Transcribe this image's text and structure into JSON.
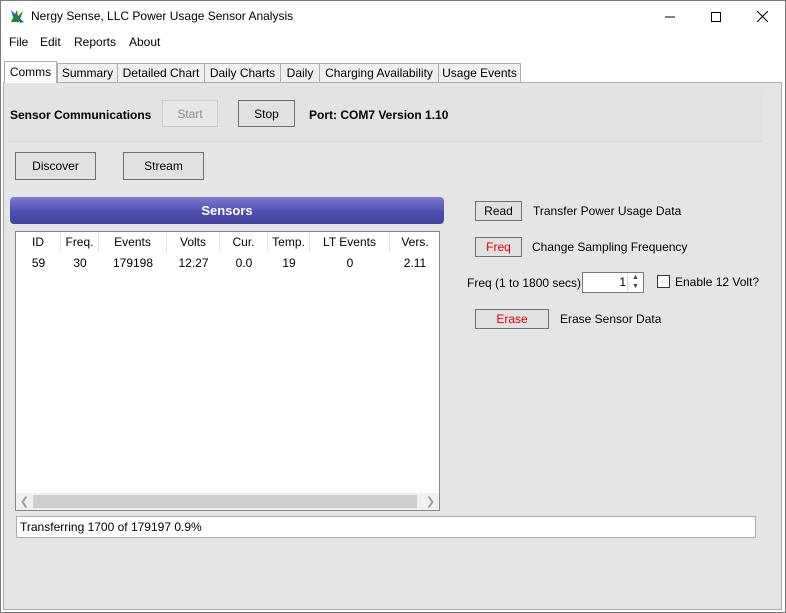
{
  "window": {
    "title": "Nergy Sense, LLC Power Usage Sensor Analysis",
    "minimize_icon": "minimize-icon",
    "maximize_icon": "maximize-icon",
    "close_icon": "close-icon"
  },
  "menu": [
    "File",
    "Edit",
    "Reports",
    "About"
  ],
  "tabs": [
    "Comms",
    "Summary",
    "Detailed Chart",
    "Daily Charts",
    "Daily",
    "Charging Availability",
    "Usage Events"
  ],
  "active_tab": "Comms",
  "comms": {
    "label": "Sensor Communications",
    "start_label": "Start",
    "stop_label": "Stop",
    "port_text": "Port: COM7 Version 1.10"
  },
  "discover_label": "Discover",
  "stream_label": "Stream",
  "sensors": {
    "title": "Sensors",
    "columns": [
      "ID",
      "Freq.",
      "Events",
      "Volts",
      "Cur.",
      "Temp.",
      "LT Events",
      "Vers."
    ],
    "rows": [
      [
        "59",
        "30",
        "179198",
        "12.27",
        "0.0",
        "19",
        "0",
        "2.11"
      ]
    ]
  },
  "actions": {
    "read_label": "Read",
    "read_desc": "Transfer Power Usage Data",
    "freq_label": "Freq",
    "freq_desc": "Change Sampling Frequency",
    "freq_range_label": "Freq (1 to 1800 secs)",
    "freq_value": "1",
    "enable12_label": "Enable 12 Volt?",
    "erase_label": "Erase",
    "erase_desc": "Erase Sensor Data"
  },
  "status_text": "Transferring 1700 of 179197 0.9%",
  "colors": {
    "sensors_header": "#4e4eb0",
    "danger_text": "#e00000"
  }
}
